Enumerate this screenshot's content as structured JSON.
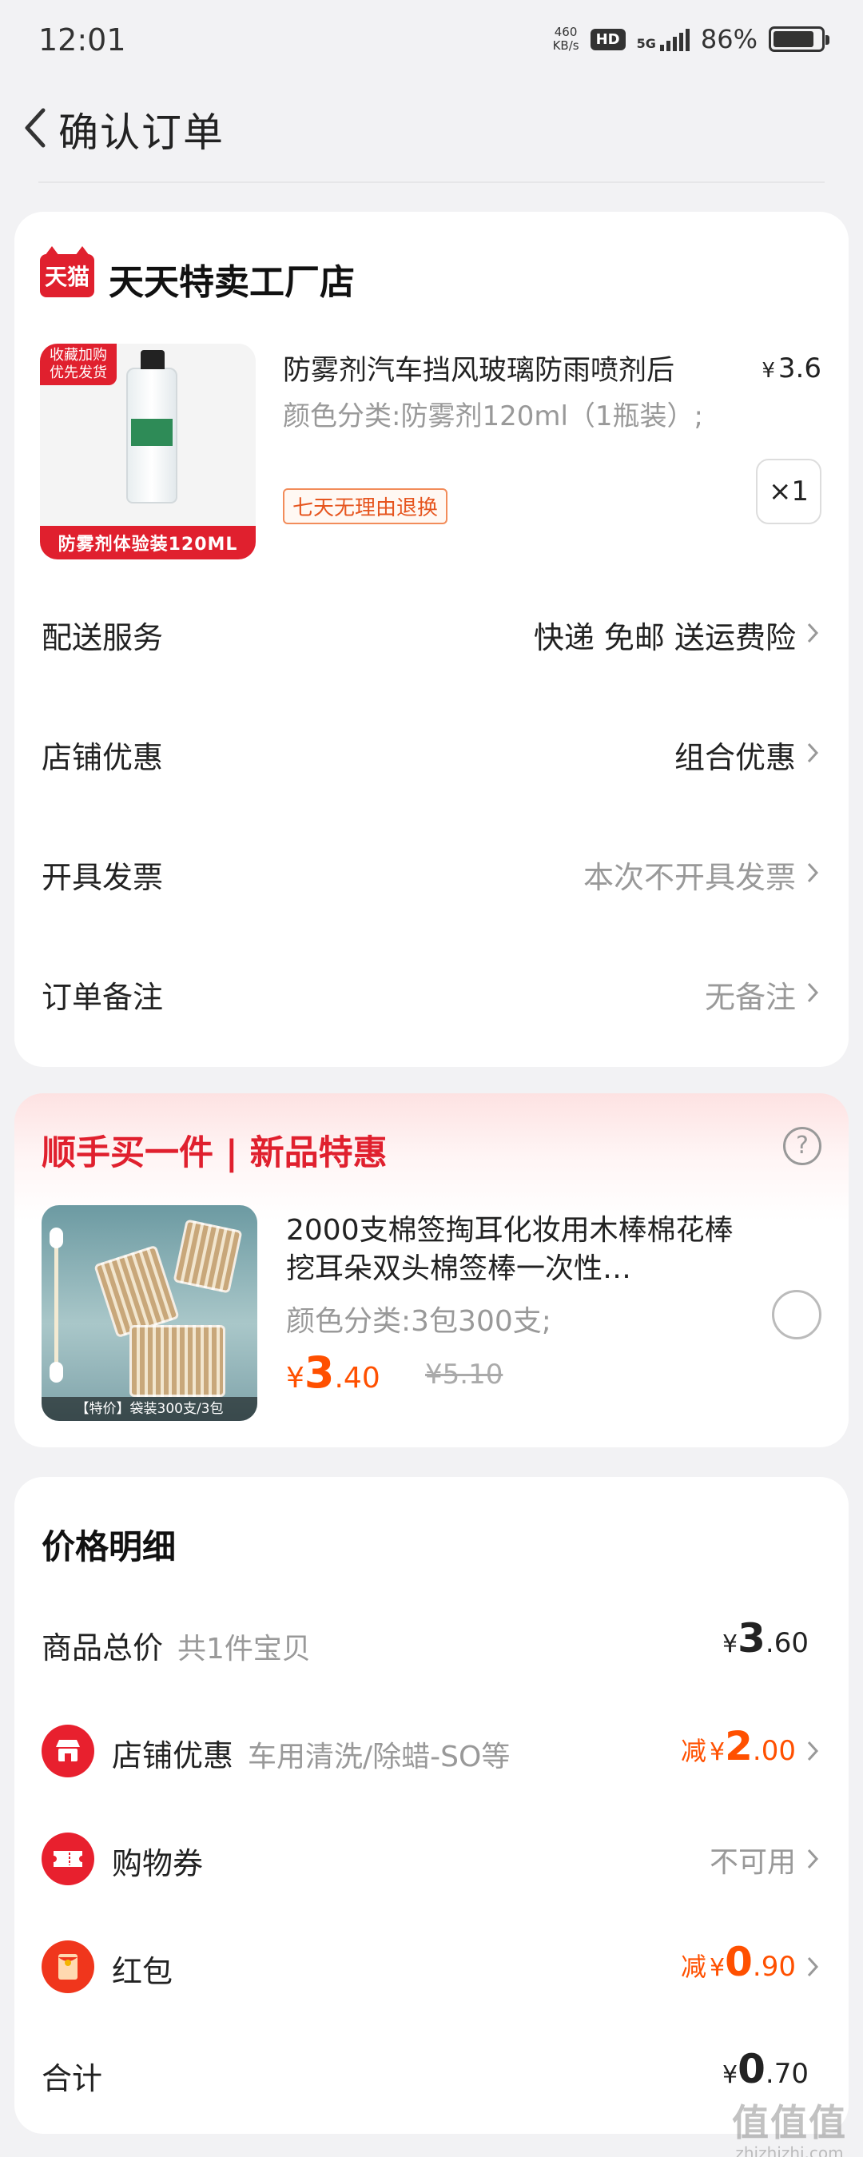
{
  "status_bar": {
    "time": "12:01",
    "net_speed": "460",
    "net_unit": "KB/s",
    "hd": "HD",
    "network": "5G",
    "battery": "86%"
  },
  "header": {
    "title": "确认订单"
  },
  "shop": {
    "logo_text": "天猫",
    "name": "天天特卖工厂店",
    "product": {
      "image_tag": "收藏加购\n优先发货",
      "image_banner": "防雾剂体验装120ML",
      "title": "防雾剂汽车挡风玻璃防雨喷剂后",
      "price_currency": "¥",
      "price": "3.6",
      "spec": "颜色分类:防雾剂120ml（1瓶装）;",
      "badge": "七天无理由退换",
      "quantity": "×1"
    },
    "rows": [
      {
        "label": "配送服务",
        "value": "快递 免邮 送运费险"
      },
      {
        "label": "店铺优惠",
        "value": "组合优惠"
      },
      {
        "label": "开具发票",
        "value": "本次不开具发票"
      },
      {
        "label": "订单备注",
        "value": "无备注"
      }
    ]
  },
  "addon": {
    "title": "顺手买一件 | 新品特惠",
    "help": "?",
    "image_caption": "【特价】袋装300支/3包",
    "name": "2000支棉签掏耳化妆用木棒棉花棒挖耳朵双头棉签棒一次性…",
    "spec": "颜色分类:3包300支;",
    "price_currency": "¥",
    "price_int": "3",
    "price_dec": ".40",
    "old_price": "¥5.10"
  },
  "price_detail": {
    "title": "价格明细",
    "total_goods": {
      "label": "商品总价",
      "sub": "共1件宝贝",
      "currency": "¥",
      "int": "3",
      "dec": ".60"
    },
    "shop_discount": {
      "label": "店铺优惠",
      "sub": "车用清洗/除蜡-SO等",
      "prefix": "减",
      "currency": "¥",
      "int": "2",
      "dec": ".00"
    },
    "coupon": {
      "label": "购物券",
      "value": "不可用"
    },
    "red_packet": {
      "label": "红包",
      "prefix": "减",
      "currency": "¥",
      "int": "0",
      "dec": ".90"
    },
    "sum": {
      "label": "合计",
      "currency": "¥",
      "int": "0",
      "dec": ".70"
    }
  },
  "watermark": {
    "logo": "值值值",
    "url": "zhizhizhi.com"
  },
  "colors": {
    "brand_red": "#e0202e",
    "price_orange": "#ff5000",
    "muted": "#999999",
    "background": "#f2f2f4"
  }
}
